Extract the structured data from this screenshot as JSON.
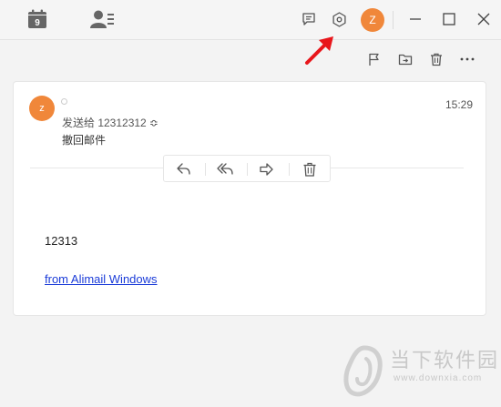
{
  "titlebar": {
    "calendar_day": "9",
    "avatar_letter": "Z"
  },
  "message": {
    "avatar_letter": "z",
    "recipient_label": "发送给 12312312 ≎",
    "recall_label": "撤回邮件",
    "time": "15:29",
    "body": "12313",
    "signature_link": "from Alimail Windows"
  },
  "watermark": {
    "text": "当下软件园",
    "url": "www.downxia.com"
  },
  "colors": {
    "accent": "#f0873a",
    "link": "#1a3bd8",
    "annotation_arrow": "#e8161b"
  }
}
